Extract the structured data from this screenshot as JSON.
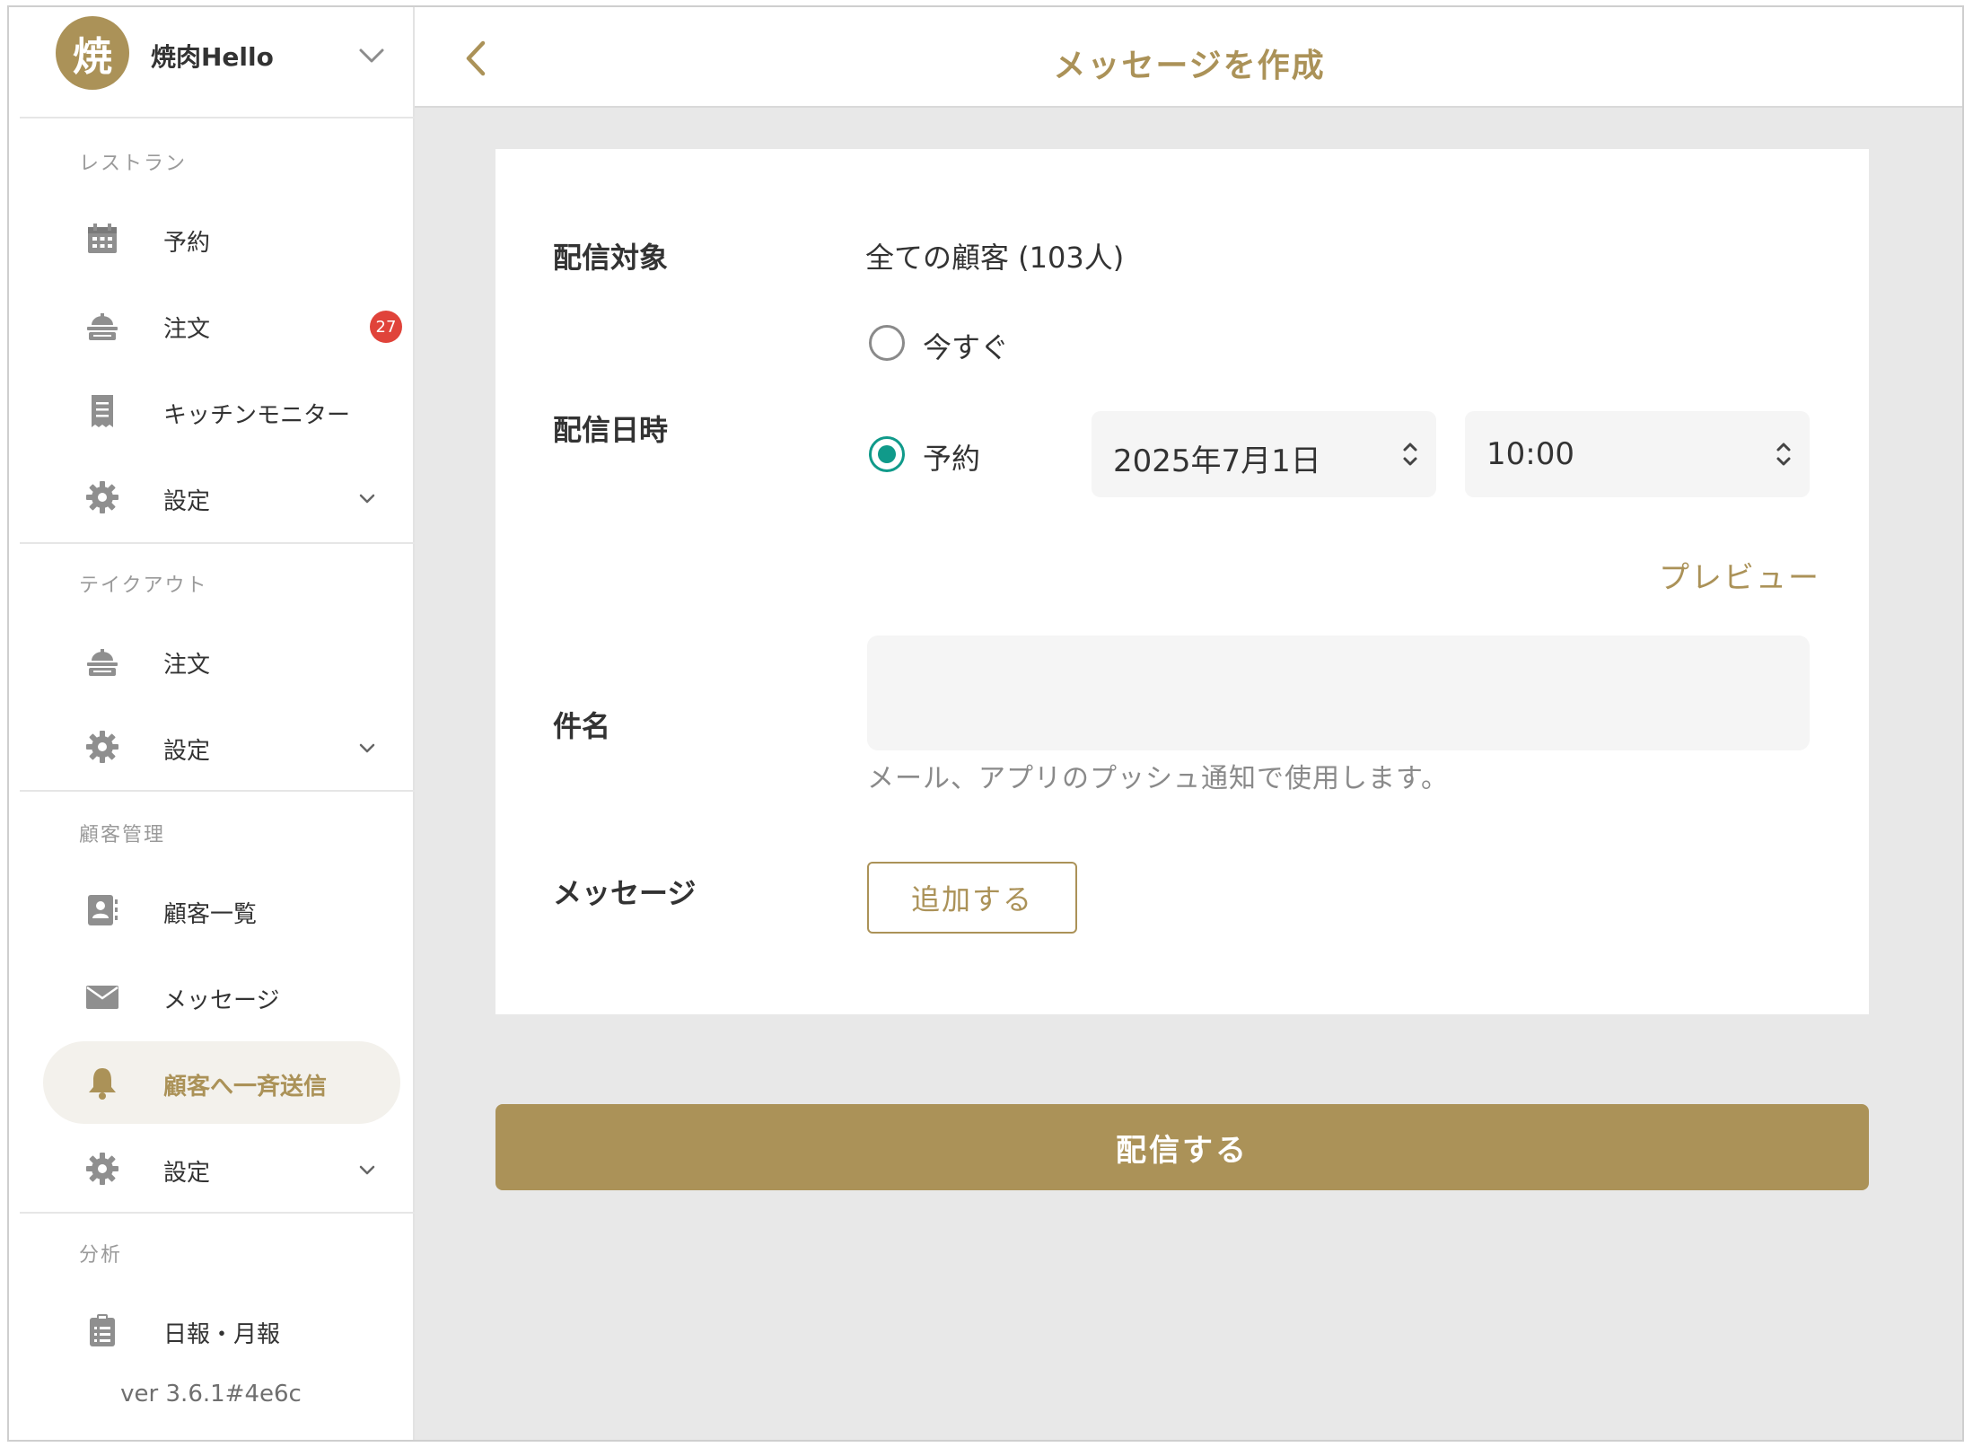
{
  "sidebar": {
    "avatar_initial": "焼",
    "restaurant_name": "焼肉Hello",
    "sections": {
      "restaurant": "レストラン",
      "takeout": "テイクアウト",
      "customers": "顧客管理",
      "analytics": "分析"
    },
    "items": {
      "reservations": "予約",
      "orders": "注文",
      "orders_badge": "27",
      "kitchen_monitor": "キッチンモニター",
      "restaurant_settings": "設定",
      "takeout_orders": "注文",
      "takeout_settings": "設定",
      "customer_list": "顧客一覧",
      "messages": "メッセージ",
      "broadcast": "顧客へ一斉送信",
      "customer_settings": "設定",
      "reports": "日報・月報"
    },
    "version": "ver 3.6.1#4e6c"
  },
  "header": {
    "title": "メッセージを作成"
  },
  "form": {
    "target_label": "配信対象",
    "target_value": "全ての顧客 (103人)",
    "datetime_label": "配信日時",
    "option_now": "今すぐ",
    "option_scheduled": "予約",
    "selected_option": "予約",
    "date_value": "2025年7月1日",
    "time_value": "10:00",
    "preview_link": "プレビュー",
    "subject_label": "件名",
    "subject_value": "",
    "subject_hint": "メール、アプリのプッシュ通知で使用します。",
    "message_label": "メッセージ",
    "add_button": "追加する",
    "submit_button": "配信する"
  },
  "colors": {
    "accent": "#ab9258",
    "radio_selected": "#109a8a",
    "badge": "#e0433a",
    "content_background": "#e8e8e8"
  },
  "icons": {
    "reservations": "calendar-icon",
    "orders": "food-tray-icon",
    "kitchen_monitor": "receipt-icon",
    "settings": "gear-icon",
    "customer_list": "contact-card-icon",
    "messages": "envelope-icon",
    "broadcast": "bell-icon",
    "reports": "clipboard-icon"
  }
}
